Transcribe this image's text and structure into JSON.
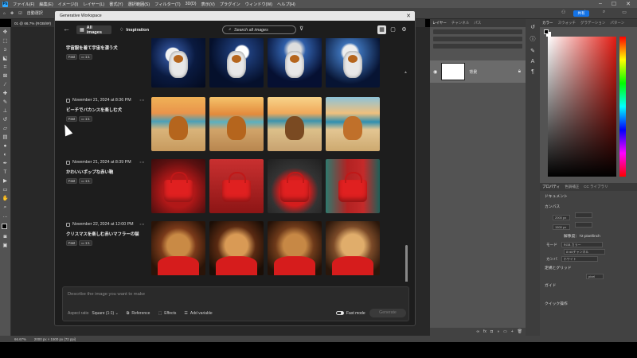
{
  "menubar": {
    "items": [
      "ファイル(F)",
      "編集(E)",
      "イメージ(I)",
      "レイヤー(L)",
      "書式(Y)",
      "選択範囲(S)",
      "フィルター(T)",
      "3D(D)",
      "表示(V)",
      "プラグイン",
      "ウィンドウ(W)",
      "ヘルプ(H)"
    ],
    "logo": "Ps"
  },
  "optionsbar": {
    "auto_select": "自動選択",
    "share": "共有"
  },
  "document": {
    "tab": "01 @ 66.7% (RGB/8#)",
    "zoom": "66.67%",
    "size": "2000 px × 1500 px (72 ppi)"
  },
  "layers_panel": {
    "tabs": [
      "レイヤー",
      "チャンネル",
      "パス"
    ],
    "layer_name": "背景"
  },
  "color_panel": {
    "tabs": [
      "カラー",
      "スウォッチ",
      "グラデーション",
      "パターン"
    ],
    "accent": "#e21b12"
  },
  "properties_panel": {
    "tabs": [
      "プロパティ",
      "色調補正",
      "CC ライブラリ"
    ],
    "doc_label": "ドキュメント",
    "canvas": "カンバス",
    "w": "2000 px",
    "h": "1500 px",
    "resolution": "解像度：72 pixel/inch",
    "mode_label": "モード",
    "mode": "RGB カラー",
    "depth": "8 bit/チャンネル",
    "bg_label": "カンバ",
    "bg_value": "ホワイト",
    "rulers": "定規とグリッド",
    "unit": "pixel",
    "guides": "ガイド",
    "quick": "クイック操作"
  },
  "dialog": {
    "title": "Generative Workspace",
    "tabs": {
      "all_images": "All images",
      "inspiration": "Inspiration"
    },
    "search_placeholder": "Search all images",
    "groups": [
      {
        "date": "",
        "prompt": "宇宙服を着て宇宙を漂う犬",
        "tags": [
          "Fast",
          "1:1"
        ],
        "scene": "space"
      },
      {
        "date": "November 21, 2024 at 8:36 PM",
        "prompt": "ビーチでバカンスを楽しむ犬",
        "tags": [
          "Fast",
          "1:1"
        ],
        "scene": "beach"
      },
      {
        "date": "November 21, 2024 at 8:39 PM",
        "prompt": "かわいいポップな赤い鞄",
        "tags": [
          "Fast",
          "1:1"
        ],
        "scene": "bag"
      },
      {
        "date": "November 22, 2024 at 12:00 PM",
        "prompt": "クリスマスを楽しむ赤いマフラーの猫",
        "tags": [
          "Fast",
          "1:1"
        ],
        "scene": "cat"
      }
    ],
    "prompt_placeholder": "Describe the image you want to make",
    "aspect_label": "Aspect ratio",
    "aspect_value": "Square (1:1)",
    "reference": "Reference",
    "effects": "Effects",
    "add_variable": "Add variable",
    "fast_mode": "Fast mode",
    "generate": "Generate"
  }
}
